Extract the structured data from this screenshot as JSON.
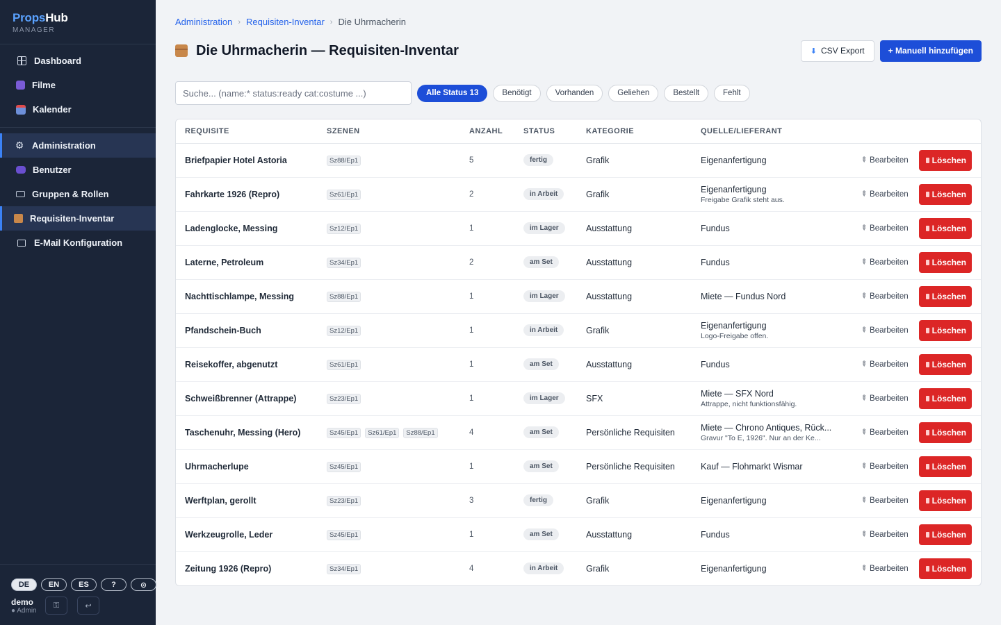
{
  "brand": {
    "name_a": "Props",
    "name_b": "Hub",
    "sub": "MANAGER"
  },
  "nav": {
    "main": [
      {
        "label": "Dashboard",
        "icon": "dashboard-icon"
      },
      {
        "label": "Filme",
        "icon": "film-icon"
      },
      {
        "label": "Kalender",
        "icon": "calendar-icon"
      }
    ],
    "admin": [
      {
        "label": "Administration",
        "icon": "gear-icon",
        "active": true
      },
      {
        "label": "Benutzer",
        "icon": "users-icon"
      },
      {
        "label": "Gruppen & Rollen",
        "icon": "tag-icon"
      },
      {
        "label": "Requisiten-Inventar",
        "icon": "box-icon",
        "active": true
      },
      {
        "label": "E-Mail Konfiguration",
        "icon": "mail-icon"
      }
    ]
  },
  "languages": [
    "DE",
    "EN",
    "ES",
    "?",
    "⊙"
  ],
  "active_language": "DE",
  "user": {
    "name": "demo",
    "role": "● Admin"
  },
  "breadcrumb": {
    "level1": "Administration",
    "level2": "Requisiten-Inventar",
    "current": "Die Uhrmacherin"
  },
  "page": {
    "title": "Die Uhrmacherin — Requisiten-Inventar",
    "csv_label": "CSV Export",
    "add_label": "+ Manuell hinzufügen"
  },
  "search": {
    "placeholder": "Suche... (name:* status:ready cat:costume ...)",
    "value": ""
  },
  "filters": [
    {
      "label": "Alle Status 13",
      "active": true
    },
    {
      "label": "Benötigt"
    },
    {
      "label": "Vorhanden"
    },
    {
      "label": "Geliehen"
    },
    {
      "label": "Bestellt"
    },
    {
      "label": "Fehlt"
    }
  ],
  "table": {
    "columns": [
      "REQUISITE",
      "SZENEN",
      "ANZAHL",
      "STATUS",
      "KATEGORIE",
      "QUELLE/LIEFERANT"
    ],
    "edit_label": "Bearbeiten",
    "delete_label": "Löschen",
    "rows": [
      {
        "name": "Briefpapier Hotel Astoria",
        "scenes": [
          "Sz88/Ep1"
        ],
        "qty": "5",
        "status": "fertig",
        "category": "Grafik",
        "source": "Eigenanfertigung",
        "note": ""
      },
      {
        "name": "Fahrkarte 1926 (Repro)",
        "scenes": [
          "Sz61/Ep1"
        ],
        "qty": "2",
        "status": "in Arbeit",
        "category": "Grafik",
        "source": "Eigenanfertigung",
        "note": "Freigabe Grafik steht aus."
      },
      {
        "name": "Ladenglocke, Messing",
        "scenes": [
          "Sz12/Ep1"
        ],
        "qty": "1",
        "status": "im Lager",
        "category": "Ausstattung",
        "source": "Fundus",
        "note": ""
      },
      {
        "name": "Laterne, Petroleum",
        "scenes": [
          "Sz34/Ep1"
        ],
        "qty": "2",
        "status": "am Set",
        "category": "Ausstattung",
        "source": "Fundus",
        "note": ""
      },
      {
        "name": "Nachttischlampe, Messing",
        "scenes": [
          "Sz88/Ep1"
        ],
        "qty": "1",
        "status": "im Lager",
        "category": "Ausstattung",
        "source": "Miete — Fundus Nord",
        "note": ""
      },
      {
        "name": "Pfandschein-Buch",
        "scenes": [
          "Sz12/Ep1"
        ],
        "qty": "1",
        "status": "in Arbeit",
        "category": "Grafik",
        "source": "Eigenanfertigung",
        "note": "Logo-Freigabe offen."
      },
      {
        "name": "Reisekoffer, abgenutzt",
        "scenes": [
          "Sz61/Ep1"
        ],
        "qty": "1",
        "status": "am Set",
        "category": "Ausstattung",
        "source": "Fundus",
        "note": ""
      },
      {
        "name": "Schweißbrenner (Attrappe)",
        "scenes": [
          "Sz23/Ep1"
        ],
        "qty": "1",
        "status": "im Lager",
        "category": "SFX",
        "source": "Miete — SFX Nord",
        "note": "Attrappe, nicht funktionsfähig."
      },
      {
        "name": "Taschenuhr, Messing (Hero)",
        "scenes": [
          "Sz45/Ep1",
          "Sz61/Ep1",
          "Sz88/Ep1"
        ],
        "qty": "4",
        "status": "am Set",
        "category": "Persönliche Requisiten",
        "source": "Miete — Chrono Antiques, Rück...",
        "note": "Gravur \"To E, 1926\". Nur an der Ke..."
      },
      {
        "name": "Uhrmacherlupe",
        "scenes": [
          "Sz45/Ep1"
        ],
        "qty": "1",
        "status": "am Set",
        "category": "Persönliche Requisiten",
        "source": "Kauf — Flohmarkt Wismar",
        "note": ""
      },
      {
        "name": "Werftplan, gerollt",
        "scenes": [
          "Sz23/Ep1"
        ],
        "qty": "3",
        "status": "fertig",
        "category": "Grafik",
        "source": "Eigenanfertigung",
        "note": ""
      },
      {
        "name": "Werkzeugrolle, Leder",
        "scenes": [
          "Sz45/Ep1"
        ],
        "qty": "1",
        "status": "am Set",
        "category": "Ausstattung",
        "source": "Fundus",
        "note": ""
      },
      {
        "name": "Zeitung 1926 (Repro)",
        "scenes": [
          "Sz34/Ep1"
        ],
        "qty": "4",
        "status": "in Arbeit",
        "category": "Grafik",
        "source": "Eigenanfertigung",
        "note": ""
      }
    ]
  }
}
